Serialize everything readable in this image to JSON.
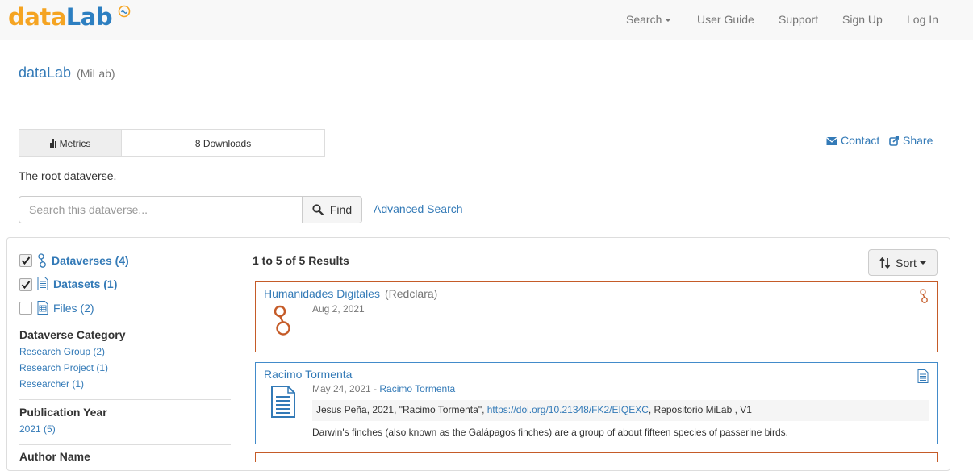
{
  "navbar": {
    "brand": {
      "data": "data",
      "lab": "Lab"
    },
    "items": [
      {
        "label": "Search"
      },
      {
        "label": "User Guide"
      },
      {
        "label": "Support"
      },
      {
        "label": "Sign Up"
      },
      {
        "label": "Log In"
      }
    ]
  },
  "header": {
    "title": "dataLab",
    "affiliation": "(MiLab)"
  },
  "metrics": {
    "label": "Metrics",
    "value": "8 Downloads"
  },
  "actions": {
    "contact": "Contact",
    "share": "Share"
  },
  "description": "The root dataverse.",
  "search": {
    "placeholder": "Search this dataverse...",
    "find_label": "Find",
    "advanced_label": "Advanced Search"
  },
  "facets": {
    "types": [
      {
        "label": "Dataverses (4)",
        "checked": true,
        "icon": "dataverse-icon"
      },
      {
        "label": "Datasets (1)",
        "checked": true,
        "icon": "dataset-icon"
      },
      {
        "label": "Files (2)",
        "checked": false,
        "icon": "file-icon"
      }
    ],
    "category": {
      "title": "Dataverse Category",
      "items": [
        "Research Group (2)",
        "Research Project (1)",
        "Researcher (1)"
      ]
    },
    "year": {
      "title": "Publication Year",
      "items": [
        "2021 (5)"
      ]
    },
    "author": {
      "title": "Author Name"
    }
  },
  "results": {
    "count": "1 to 5 of 5 Results",
    "sort_label": "Sort",
    "cards": [
      {
        "type": "dataverse",
        "title": "Humanidades Digitales",
        "affiliation": "(Redclara)",
        "date": "Aug 2, 2021"
      },
      {
        "type": "dataset",
        "title": "Racimo Tormenta",
        "date": "May 24, 2021",
        "separator": " - ",
        "parent": "Racimo Tormenta",
        "citation_pre": "Jesus Peña, 2021, \"Racimo Tormenta\", ",
        "citation_doi": "https://doi.org/10.21348/FK2/EIQEXC",
        "citation_post": ", Repositorio MiLab , V1",
        "description": "Darwin's finches (also known as the Galápagos finches) are a group of about fifteen species of passerine birds."
      }
    ]
  },
  "colors": {
    "link": "#337ab7",
    "dataverse_accent": "#c55b28",
    "dataset_accent": "#428bca",
    "brand_orange": "#f5a422",
    "brand_blue": "#2d7fc1"
  }
}
